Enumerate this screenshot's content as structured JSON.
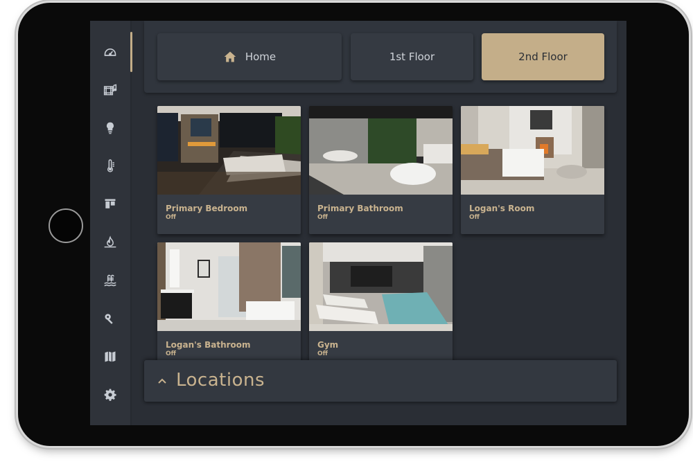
{
  "tabs": {
    "home": "Home",
    "first_floor": "1st Floor",
    "second_floor": "2nd Floor"
  },
  "rooms": [
    {
      "name": "Primary Bedroom",
      "status": "Off"
    },
    {
      "name": "Primary Bathroom",
      "status": "Off"
    },
    {
      "name": "Logan's Room",
      "status": "Off"
    },
    {
      "name": "Logan's Bathroom",
      "status": "Off"
    },
    {
      "name": "Gym",
      "status": "Off"
    }
  ],
  "locations": {
    "label": "Locations"
  },
  "sidebar_icons": [
    "dashboard-icon",
    "media-icon",
    "lightbulb-icon",
    "thermometer-icon",
    "shades-icon",
    "fire-icon",
    "pool-icon",
    "key-icon",
    "map-icon",
    "gear-icon"
  ],
  "colors": {
    "accent": "#c4ae89",
    "background": "#2a2e35",
    "card": "#363b43"
  }
}
